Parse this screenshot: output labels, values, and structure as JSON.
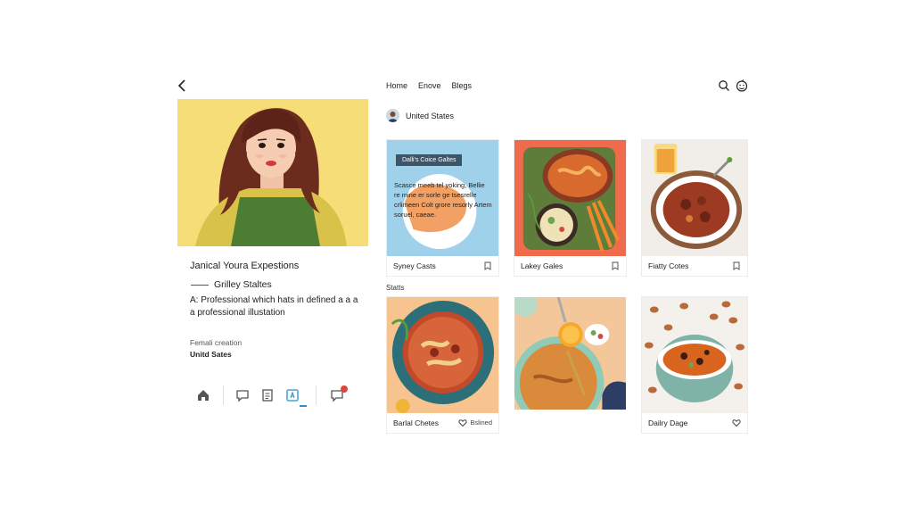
{
  "profile": {
    "title": "Janical Youra Expestions",
    "subtitle": "Grilley Staltes",
    "description": "A: Professional which hats in defined a a a a professional illustation",
    "meta_label": "Femali creation",
    "meta_value": "Unitd Sates"
  },
  "nav": {
    "links": [
      "Home",
      "Enove",
      "Blegs"
    ]
  },
  "location": {
    "label": "United States"
  },
  "section": {
    "label": "Statts"
  },
  "cards": [
    {
      "title": "Syney Casts",
      "icon": "bookmark-icon",
      "chip": "Dalli's Coice Galtes",
      "blurb": "Scasce meeb tel yoking, Bellie re mine er sorle ge tsesrelle crlimeen Colt grore resorly Artem soruel, caeae."
    },
    {
      "title": "Lakey Gales",
      "icon": "bookmark-icon"
    },
    {
      "title": "Fiatty Cotes",
      "icon": "bookmark-icon"
    },
    {
      "title": "Barlal Chetes",
      "icon": "heart-icon",
      "saved_label": "Bslined"
    },
    {
      "title": "",
      "icon": ""
    },
    {
      "title": "Dailry Dage",
      "icon": "heart-icon"
    }
  ],
  "colors": {
    "hero_bg": "#f6dd77",
    "accent": "#2a8fd0",
    "badge": "#e0443a"
  }
}
